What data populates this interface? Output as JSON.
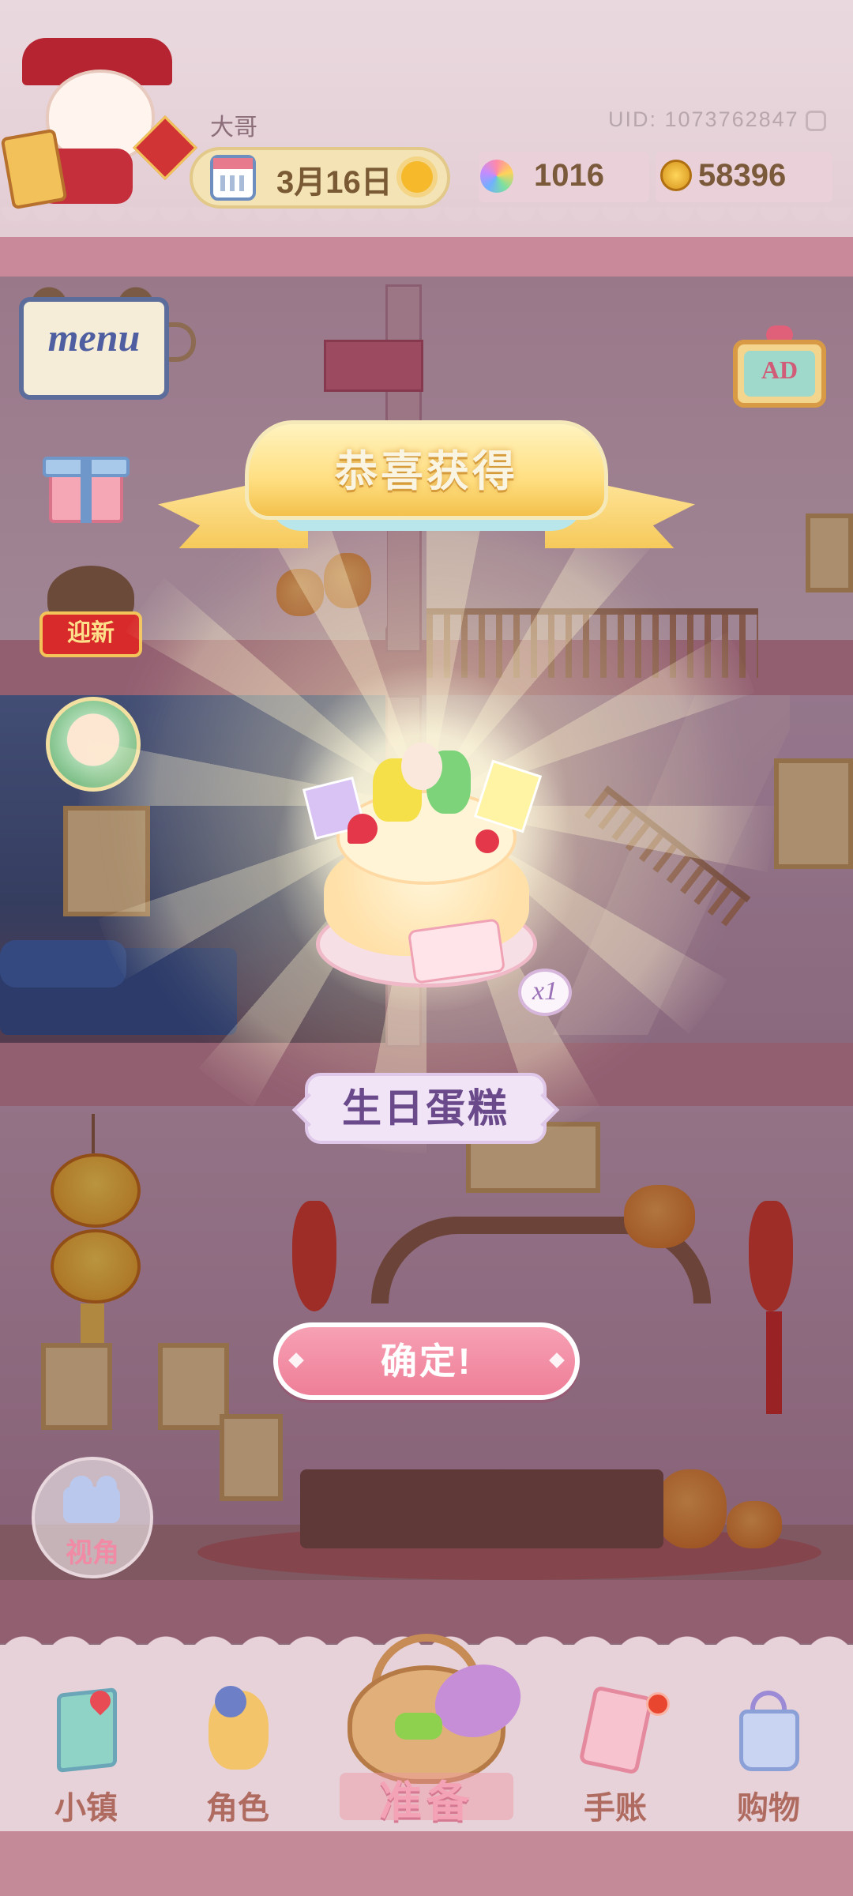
{
  "header": {
    "username": "大哥",
    "uid": "UID: 1073762847",
    "date": "3月16日",
    "gems": "1016",
    "coins": "58396"
  },
  "side_buttons": {
    "menu_label": "menu",
    "new_year_label": "迎新",
    "ad_label": "AD"
  },
  "popup": {
    "title": "恭喜获得",
    "item_name": "生日蛋糕",
    "quantity": "x1",
    "confirm_label": "确定!"
  },
  "camera": {
    "label": "视角"
  },
  "bottom_nav": {
    "items": [
      {
        "label": "小镇",
        "icon": "map-icon"
      },
      {
        "label": "角色",
        "icon": "character-icon"
      },
      {
        "label": "准备",
        "icon": "basket-icon"
      },
      {
        "label": "手账",
        "icon": "journal-icon"
      },
      {
        "label": "购物",
        "icon": "shopping-bag-icon"
      }
    ]
  },
  "colors": {
    "confirm_button": "#ee7f98",
    "banner": "#ffdf82",
    "item_name_bg": "#f1e4f6",
    "notification_dot": "#e9462f"
  }
}
